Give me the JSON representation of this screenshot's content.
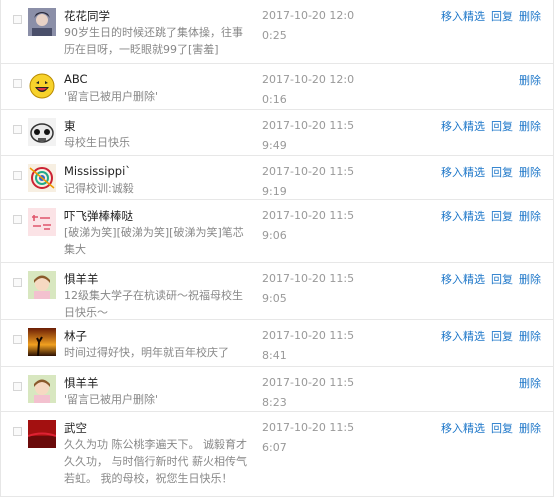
{
  "messages": [
    {
      "name": "花花同学",
      "content": "90岁生日的时候还跳了集体操，往事历在目呀，一眨眼就99了[害羞]",
      "time": "2017-10-20 12:00:25",
      "actions": [
        "移入精选",
        "回复",
        "删除"
      ],
      "avatar_icon": "avatar-photo-icon"
    },
    {
      "name": "ABC",
      "content": "'留言已被用户删除'",
      "time": "2017-10-20 12:00:16",
      "actions": [
        "删除"
      ],
      "avatar_icon": "laughing-face-icon"
    },
    {
      "name": "東",
      "content": "母校生日快乐",
      "time": "2017-10-20 11:59:49",
      "actions": [
        "移入精选",
        "回复",
        "删除"
      ],
      "avatar_icon": "robot-avatar-icon"
    },
    {
      "name": "Mississippi`",
      "content": "记得校训:诚毅",
      "time": "2017-10-20 11:59:19",
      "actions": [
        "移入精选",
        "回复",
        "删除"
      ],
      "avatar_icon": "colorful-avatar-icon"
    },
    {
      "name": "吓飞弹棒棒哒",
      "content": "[破涕为笑][破涕为笑][破涕为笑]笔芯集大",
      "time": "2017-10-20 11:59:06",
      "actions": [
        "移入精选",
        "回复",
        "删除"
      ],
      "avatar_icon": "pink-text-avatar-icon"
    },
    {
      "name": "惧羊羊",
      "content": "12级集大学子在杭读研～祝福母校生日快乐～",
      "time": "2017-10-20 11:59:05",
      "actions": [
        "移入精选",
        "回复",
        "删除"
      ],
      "avatar_icon": "girl-avatar-icon"
    },
    {
      "name": "林子",
      "content": "时间过得好快，明年就百年校庆了",
      "time": "2017-10-20 11:58:41",
      "actions": [
        "移入精选",
        "回复",
        "删除"
      ],
      "avatar_icon": "sunset-avatar-icon"
    },
    {
      "name": "惧羊羊",
      "content": "'留言已被用户删除'",
      "time": "2017-10-20 11:58:23",
      "actions": [
        "删除"
      ],
      "avatar_icon": "girl-avatar-icon"
    },
    {
      "name": "武空",
      "content": "久久为功 陈公桃李遍天下。 诚毅育才久久功， 与时偕行新时代 薪火相传气若虹。 我的母校，祝您生日快乐！",
      "time": "2017-10-20 11:56:07",
      "actions": [
        "移入精选",
        "回复",
        "删除"
      ],
      "avatar_icon": "red-landscape-avatar-icon"
    }
  ]
}
